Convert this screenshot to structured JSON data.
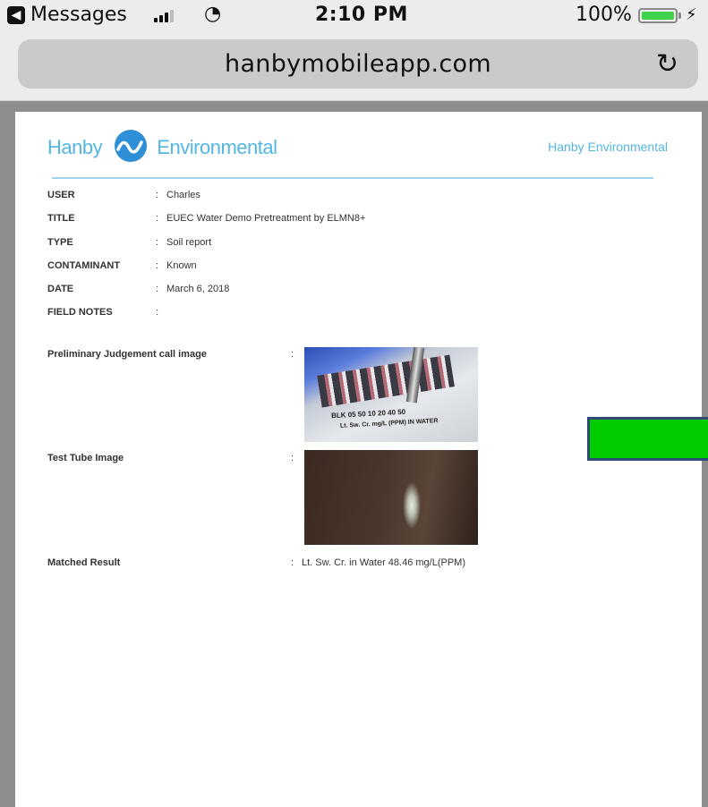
{
  "status_bar": {
    "app_label": "Messages",
    "time": "2:10 PM",
    "battery_percent": "100%",
    "battery_level": 1.0
  },
  "browser": {
    "url": "hanbymobileapp.com"
  },
  "report": {
    "logo_left": "Hanby",
    "logo_right": "Environmental",
    "header_company": "Hanby Environmental",
    "fields": [
      {
        "label": "USER",
        "value": "Charles"
      },
      {
        "label": "TITLE",
        "value": "EUEC Water Demo Pretreatment by ELMN8+"
      },
      {
        "label": "TYPE",
        "value": "Soil report"
      },
      {
        "label": "CONTAMINANT",
        "value": "Known"
      },
      {
        "label": "DATE",
        "value": "March 6, 2018"
      },
      {
        "label": "FIELD NOTES",
        "value": ""
      }
    ],
    "preliminary_label": "Preliminary Judgement call image",
    "photo1_scale": "BLK  05  50  10  20  40  50",
    "photo1_caption": "Lt. Sw. Cr. mg/L (PPM) IN WATER",
    "test_tube_label": "Test Tube Image",
    "matched_label": "Matched Result",
    "matched_value": "Lt. Sw. Cr. in Water 48.46 mg/L(PPM)"
  },
  "colors": {
    "brand": "#53b7e2",
    "overlay": "#00cc00"
  }
}
